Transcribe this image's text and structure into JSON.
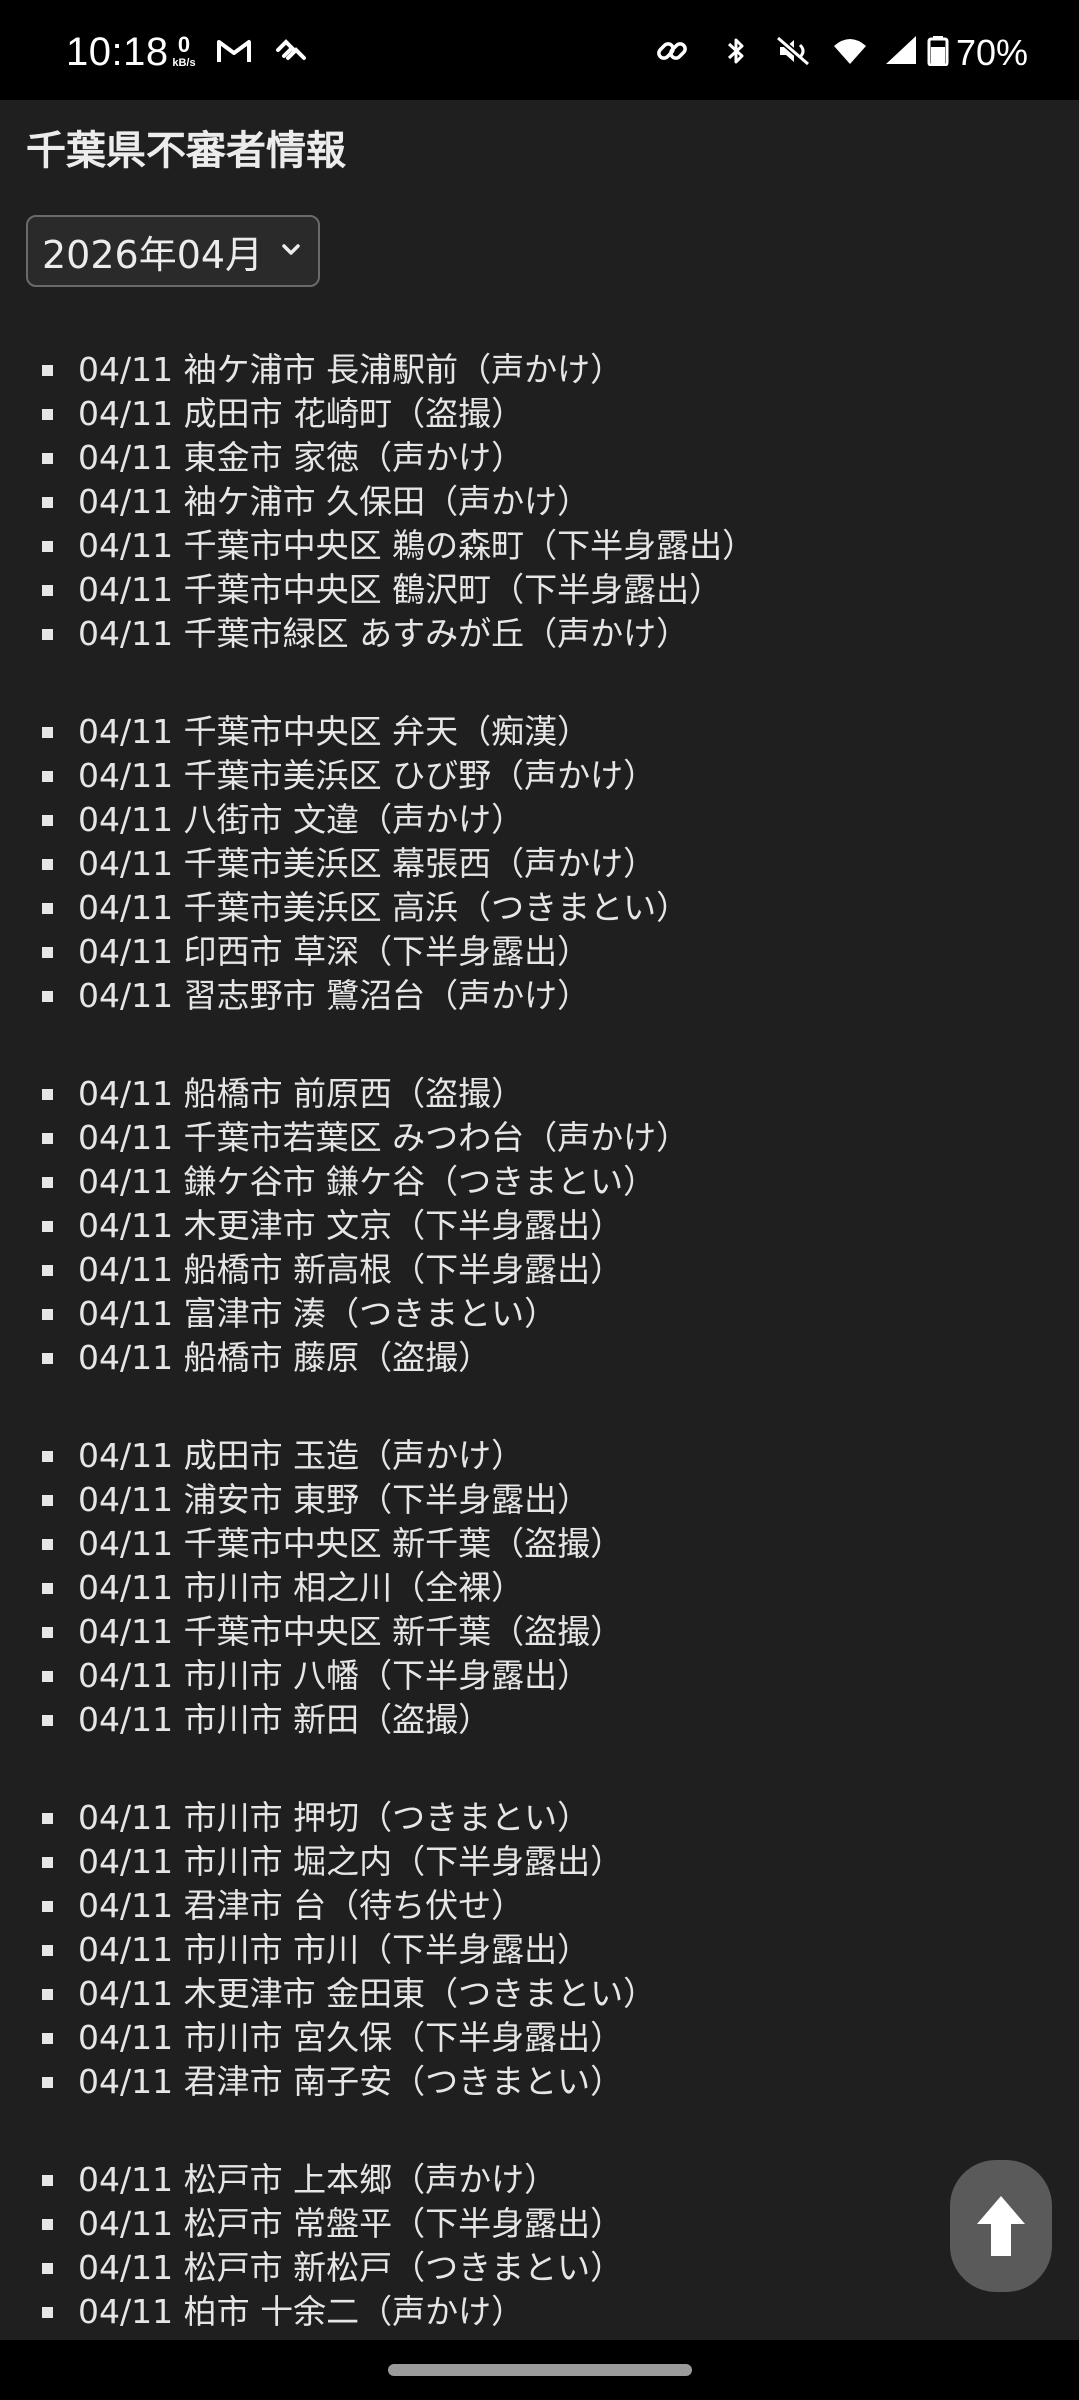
{
  "status_bar": {
    "time": "10:18",
    "net_speed_value": "0",
    "net_speed_unit": "kB/s",
    "battery_percent": "70%",
    "left_icons": [
      "gmail-icon",
      "app-notification-icon"
    ],
    "right_icons": [
      "link-icon",
      "bluetooth-icon",
      "mute-icon",
      "wifi-icon",
      "signal-icon",
      "battery-icon"
    ]
  },
  "page": {
    "title": "千葉県不審者情報",
    "month_select": {
      "value": "2026年04月"
    }
  },
  "groups": [
    [
      "04/11 袖ケ浦市 長浦駅前（声かけ）",
      "04/11 成田市 花崎町（盗撮）",
      "04/11 東金市 家徳（声かけ）",
      "04/11 袖ケ浦市 久保田（声かけ）",
      "04/11 千葉市中央区 鵜の森町（下半身露出）",
      "04/11 千葉市中央区 鶴沢町（下半身露出）",
      "04/11 千葉市緑区 あすみが丘（声かけ）"
    ],
    [
      "04/11 千葉市中央区 弁天（痴漢）",
      "04/11 千葉市美浜区 ひび野（声かけ）",
      "04/11 八街市 文違（声かけ）",
      "04/11 千葉市美浜区 幕張西（声かけ）",
      "04/11 千葉市美浜区 高浜（つきまとい）",
      "04/11 印西市 草深（下半身露出）",
      "04/11 習志野市 鷺沼台（声かけ）"
    ],
    [
      "04/11 船橋市 前原西（盗撮）",
      "04/11 千葉市若葉区 みつわ台（声かけ）",
      "04/11 鎌ケ谷市 鎌ケ谷（つきまとい）",
      "04/11 木更津市 文京（下半身露出）",
      "04/11 船橋市 新高根（下半身露出）",
      "04/11 富津市 湊（つきまとい）",
      "04/11 船橋市 藤原（盗撮）"
    ],
    [
      "04/11 成田市 玉造（声かけ）",
      "04/11 浦安市 東野（下半身露出）",
      "04/11 千葉市中央区 新千葉（盗撮）",
      "04/11 市川市 相之川（全裸）",
      "04/11 千葉市中央区 新千葉（盗撮）",
      "04/11 市川市 八幡（下半身露出）",
      "04/11 市川市 新田（盗撮）"
    ],
    [
      "04/11 市川市 押切（つきまとい）",
      "04/11 市川市 堀之内（下半身露出）",
      "04/11 君津市 台（待ち伏せ）",
      "04/11 市川市 市川（下半身露出）",
      "04/11 木更津市 金田東（つきまとい）",
      "04/11 市川市 宮久保（下半身露出）",
      "04/11 君津市 南子安（つきまとい）"
    ],
    [
      "04/11 松戸市 上本郷（声かけ）",
      "04/11 松戸市 常盤平（下半身露出）",
      "04/11 松戸市 新松戸（つきまとい）",
      "04/11 柏市 十余二（声かけ）"
    ]
  ],
  "scroll_top_button": {
    "icon": "arrow-up-icon"
  },
  "colors": {
    "page_background": "#1f1f1f",
    "status_bar_background": "#000000",
    "text": "#ececec",
    "scroll_top_background": "#5a5a5a"
  }
}
